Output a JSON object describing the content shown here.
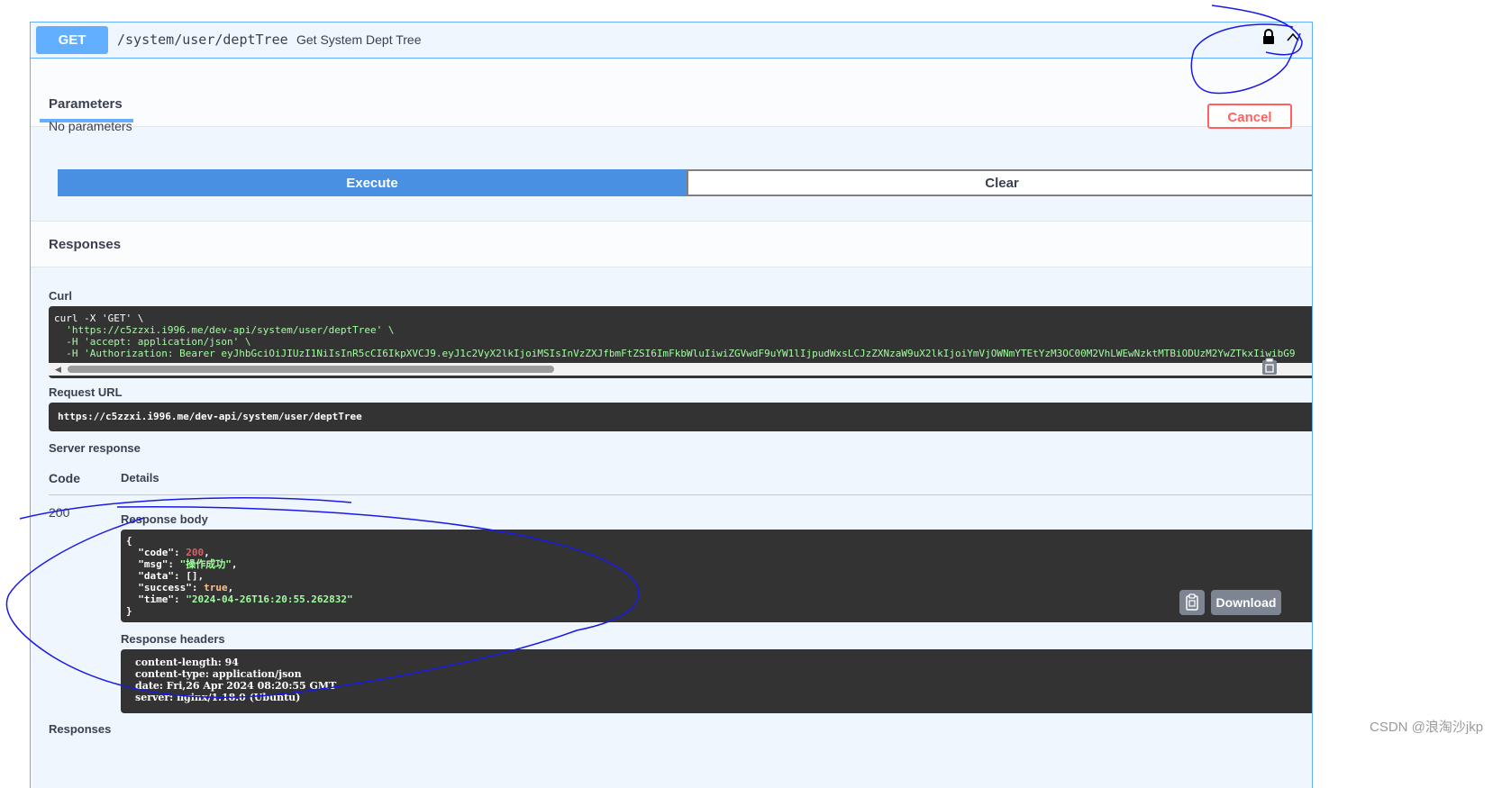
{
  "operation": {
    "method": "GET",
    "path": "/system/user/deptTree",
    "summary": "Get System Dept Tree"
  },
  "parameters": {
    "tab_label": "Parameters",
    "cancel_label": "Cancel",
    "empty_text": "No parameters"
  },
  "actions": {
    "execute_label": "Execute",
    "clear_label": "Clear"
  },
  "responses": {
    "title": "Responses",
    "curl_label": "Curl",
    "curl_lines": [
      "curl -X 'GET' \\",
      "  'https://c5zzxi.i996.me/dev-api/system/user/deptTree' \\",
      "  -H 'accept: application/json' \\",
      "  -H 'Authorization: Bearer eyJhbGciOiJIUzI1NiIsInR5cCI6IkpXVCJ9.eyJ1c2VyX2lkIjoiMSIsInVzZXJfbmFtZSI6ImFkbWluIiwiZGVwdF9uYW1lIjpudWxsLCJzZXNzaW9uX2lkIjoiYmVjOWNmYTEtYzM3OC00M2VhLWEwNzktMTBiODUzM2YwZTkxIiwibG9"
    ],
    "request_url_label": "Request URL",
    "request_url": "https://c5zzxi.i996.me/dev-api/system/user/deptTree",
    "server_response_label": "Server response",
    "code_header": "Code",
    "details_header": "Details",
    "status_code": "200",
    "response_body_label": "Response body",
    "response_body": {
      "open": "{",
      "code_key": "  \"code\": ",
      "code_val": "200",
      "msg_key": "  \"msg\": ",
      "msg_val": "\"操作成功\"",
      "data_line": "  \"data\": [],",
      "success_key": "  \"success\": ",
      "success_val": "true",
      "time_key": "  \"time\": ",
      "time_val": "\"2024-04-26T16:20:55.262832\"",
      "close": "}"
    },
    "download_label": "Download",
    "response_headers_label": "Response headers",
    "headers": [
      "content-length: 94",
      "content-type: application/json",
      "date: Fri,26 Apr 2024 08:20:55 GMT",
      "server: nginx/1.18.0 (Ubuntu)"
    ],
    "bottom_label": "Responses"
  },
  "watermark": "CSDN @浪淘沙jkp",
  "colors": {
    "get_blue": "#61affe",
    "execute_blue": "#4990e2",
    "cancel_red": "#ff6060",
    "annotation_ink": "#1a1ae6"
  }
}
